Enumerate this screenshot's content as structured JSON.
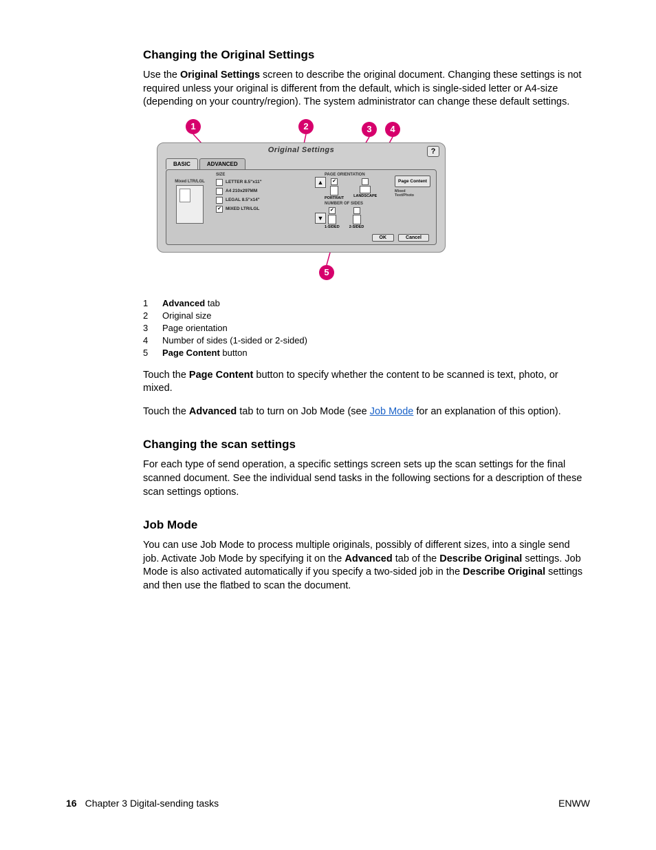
{
  "sections": {
    "s1": {
      "heading": "Changing the Original Settings",
      "para1_a": "Use the ",
      "para1_b": "Original Settings",
      "para1_c": " screen to describe the original document. Changing these settings is not required unless your original is different from the default, which is single-sided letter or A4-size (depending on your country/region). The system administrator can change these default settings.",
      "para2_a": "Touch the ",
      "para2_b": "Page Content",
      "para2_c": " button to specify whether the content to be scanned is text, photo, or mixed.",
      "para3_a": "Touch the ",
      "para3_b": "Advanced",
      "para3_c": " tab to turn on Job Mode (see ",
      "para3_link": "Job Mode",
      "para3_d": " for an explanation of this option)."
    },
    "s2": {
      "heading": "Changing the scan settings",
      "para": "For each type of send operation, a specific settings screen sets up the scan settings for the final scanned document. See the individual send tasks in the following sections for a description of these scan settings options."
    },
    "s3": {
      "heading": "Job Mode",
      "para_a": "You can use Job Mode to process multiple originals, possibly of different sizes, into a single send job. Activate Job Mode by specifying it on the ",
      "para_b": "Advanced",
      "para_c": " tab of the ",
      "para_d": "Describe Original",
      "para_e": " settings. Job Mode is also activated automatically if you specify a two-sided job in the ",
      "para_f": "Describe Original",
      "para_g": " settings and then use the flatbed to scan the document."
    }
  },
  "legend": [
    {
      "n": "1",
      "bold": "Advanced",
      "rest": " tab"
    },
    {
      "n": "2",
      "bold": "",
      "rest": "Original size"
    },
    {
      "n": "3",
      "bold": "",
      "rest": "Page orientation"
    },
    {
      "n": "4",
      "bold": "",
      "rest": "Number of sides (1-sided or 2-sided)"
    },
    {
      "n": "5",
      "bold": "Page Content",
      "rest": " button"
    }
  ],
  "callouts": {
    "c1": "1",
    "c2": "2",
    "c3": "3",
    "c4": "4",
    "c5": "5"
  },
  "device": {
    "title": "Original Settings",
    "help": "?",
    "tab_basic": "BASIC",
    "tab_advanced": "ADVANCED",
    "preview_label": "Mixed LTR/LGL",
    "size_group": "SIZE",
    "sizes": [
      "LETTER 8.5\"x11\"",
      "A4 210x297MM",
      "LEGAL 8.5\"x14\"",
      "MIXED LTR/LGL"
    ],
    "orient_group": "PAGE ORIENTATION",
    "orient_portrait": "PORTRAIT",
    "orient_landscape": "LANDSCAPE",
    "sides_group": "NUMBER OF SIDES",
    "sides_1": "1-SIDED",
    "sides_2": "2-SIDED",
    "page_content_btn": "Page Content",
    "mixed_label": "Mixed",
    "textphoto_label": "Text/Photo",
    "ok": "OK",
    "cancel": "Cancel"
  },
  "footer": {
    "page": "16",
    "chapter": "Chapter 3  Digital-sending tasks",
    "right": "ENWW"
  }
}
